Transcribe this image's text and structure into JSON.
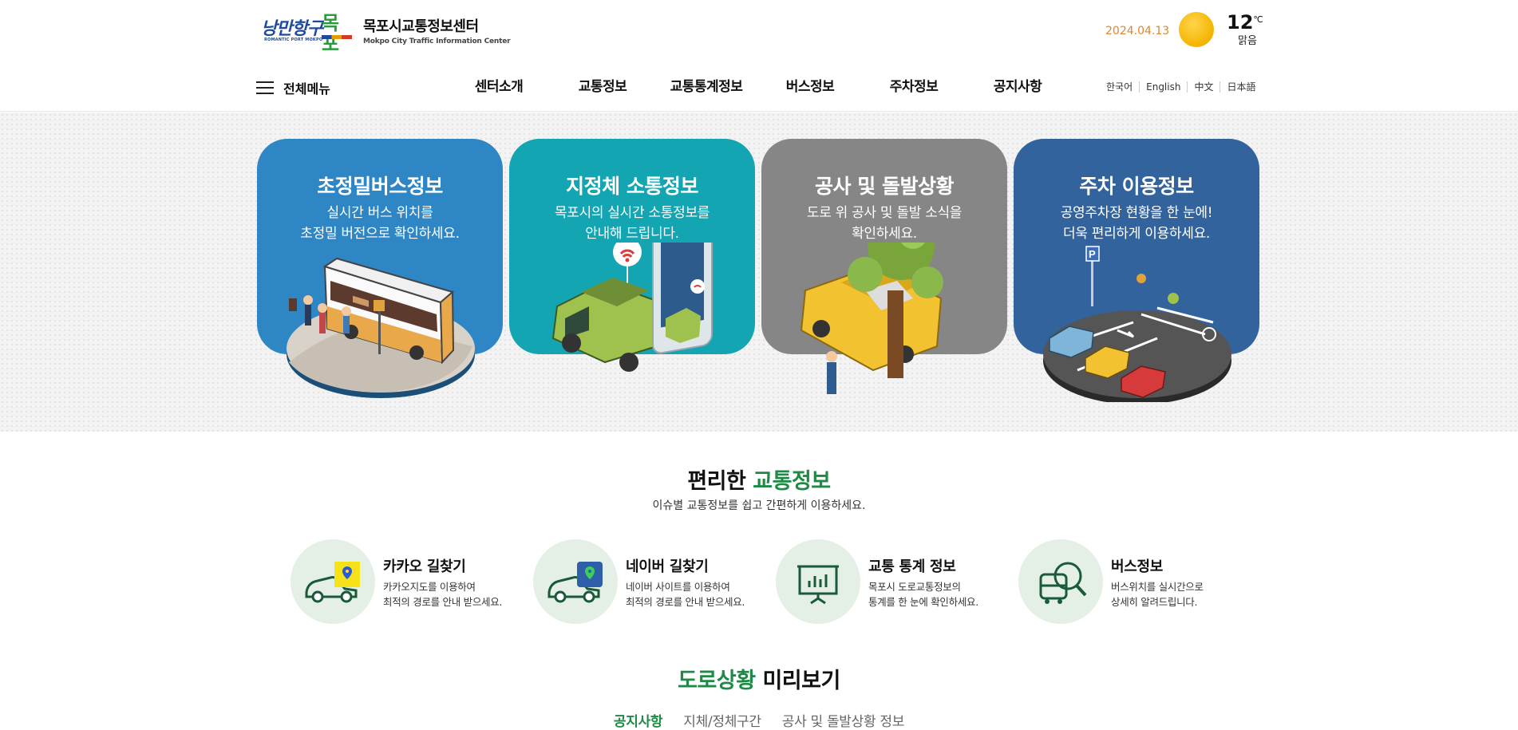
{
  "header": {
    "logo": {
      "slogan": "낭만항구",
      "slogan_en": "ROMANTIC PORT MOKPO",
      "city_mark": "목포",
      "title": "목포시교통정보센터",
      "subtitle": "Mokpo City Traffic Information Center"
    },
    "weather": {
      "date": "2024.04.13",
      "icon": "sun-icon",
      "temp": "12",
      "unit": "℃",
      "condition": "맑음"
    }
  },
  "nav": {
    "menu_label": "전체메뉴",
    "items": [
      "센터소개",
      "교통정보",
      "교통통계정보",
      "버스정보",
      "주차정보",
      "공지사항"
    ],
    "languages": [
      "한국어",
      "English",
      "中文",
      "日本語"
    ]
  },
  "hero_cards": [
    {
      "title": "초정밀버스정보",
      "desc1": "실시간 버스 위치를",
      "desc2": "초정밀 버전으로 확인하세요.",
      "color": "#2e86c5",
      "icon": "bus-stop-illustration"
    },
    {
      "title": "지정체 소통정보",
      "desc1": "목포시의 실시간 소통정보를",
      "desc2": "안내해 드립니다.",
      "color": "#14a5b2",
      "icon": "car-phone-illustration"
    },
    {
      "title": "공사 및 돌발상황",
      "desc1": "도로 위 공사 및 돌발 소식을",
      "desc2": "확인하세요.",
      "color": "#868686",
      "icon": "accident-illustration"
    },
    {
      "title": "주차 이용정보",
      "desc1": "공영주차장 현황을 한 눈에!",
      "desc2": "더욱 편리하게 이용하세요.",
      "color": "#33639c",
      "icon": "parking-illustration"
    }
  ],
  "traffic_section": {
    "title_a": "편리한 ",
    "title_b": "교통정보",
    "subtitle": "이슈별 교통정보를 쉽고 간편하게 이용하세요.",
    "items": [
      {
        "title": "카카오 길찾기",
        "desc1": "카카오지도를 이용하여",
        "desc2": "최적의 경로를 안내 받으세요.",
        "icon": "kakao-route-icon"
      },
      {
        "title": "네이버 길찾기",
        "desc1": "네이버 사이트를 이용하여",
        "desc2": "최적의 경로를 안내 받으세요.",
        "icon": "naver-route-icon"
      },
      {
        "title": "교통 통계 정보",
        "desc1": "목포시 도로교통정보의",
        "desc2": "통계를 한 눈에 확인하세요.",
        "icon": "statistics-board-icon"
      },
      {
        "title": "버스정보",
        "desc1": "버스위치를 실시간으로",
        "desc2": "상세히 알려드립니다.",
        "icon": "bus-search-icon"
      }
    ]
  },
  "road_section": {
    "title_a": "도로상황",
    "title_b": " 미리보기",
    "tabs": [
      "공지사항",
      "지체/정체구간",
      "공사 및 돌발상황 정보"
    ],
    "active_tab": "공지사항"
  },
  "colors": {
    "accent_green": "#1f8a46",
    "date_orange": "#e2852a"
  }
}
